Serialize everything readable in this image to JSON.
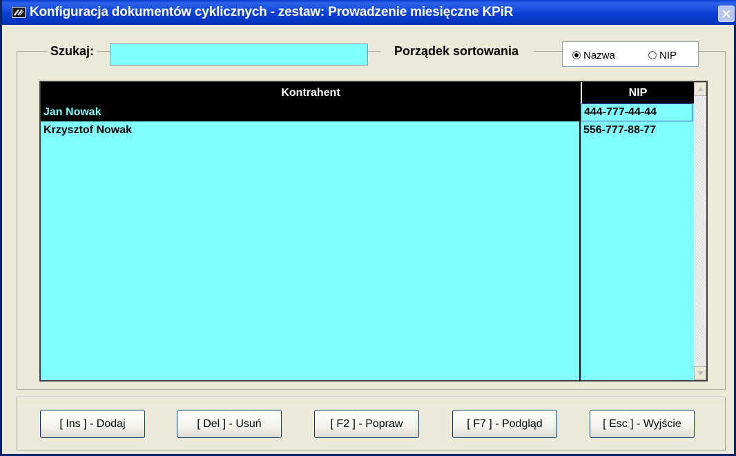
{
  "window": {
    "title": "Konfiguracja dokumentów cyklicznych - zestaw: Prowadzenie miesięczne KPiR",
    "app_icon": "app-logo-icon",
    "close_icon": "close-icon"
  },
  "search": {
    "label": "Szukaj:",
    "value": "",
    "placeholder": ""
  },
  "sort": {
    "label": "Porządek sortowania",
    "options": [
      {
        "label": "Nazwa",
        "selected": true
      },
      {
        "label": "NIP",
        "selected": false
      }
    ]
  },
  "table": {
    "columns": [
      "Kontrahent",
      "NIP"
    ],
    "rows": [
      {
        "name": "Jan Nowak",
        "nip": "444-777-44-44",
        "selected": true
      },
      {
        "name": "Krzysztof Nowak",
        "nip": "556-777-88-77",
        "selected": false
      }
    ]
  },
  "buttons": {
    "add": "[ Ins ] - Dodaj",
    "delete": "[ Del ] - Usuń",
    "edit": "[ F2 ] - Popraw",
    "preview": "[ F7 ] - Podgląd",
    "exit": "[ Esc ] - Wyjście"
  },
  "colors": {
    "accent": "#7fffff",
    "title_bar": "#0a3bd0",
    "header": "#000000"
  }
}
